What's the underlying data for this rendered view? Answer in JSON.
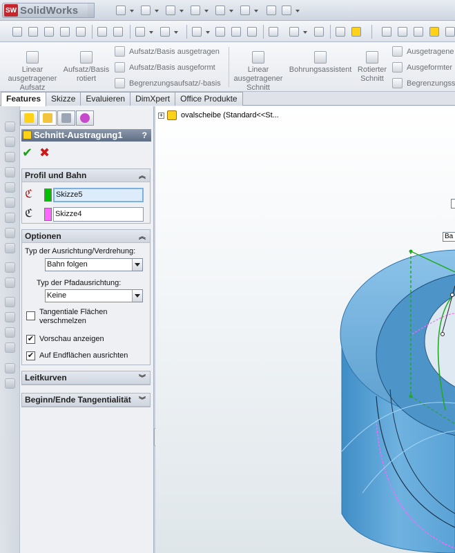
{
  "app": {
    "logo_mark": "SW",
    "title": "SolidWorks"
  },
  "command_manager": {
    "big_buttons": [
      {
        "id": "linear-extruded-boss",
        "label": "Linear\nausgetragener\nAufsatz"
      },
      {
        "id": "revolved-boss",
        "label": "Aufsatz/Basis\nrotiert"
      },
      {
        "id": "linear-extruded-cut",
        "label": "Linear\nausgetragener\nSchnitt"
      },
      {
        "id": "hole-wizard",
        "label": "Bohrungsassistent"
      },
      {
        "id": "revolved-cut",
        "label": "Rotierter\nSchnitt"
      }
    ],
    "small_buttons_col1": [
      "Aufsatz/Basis ausgetragen",
      "Aufsatz/Basis ausgeformt",
      "Begrenzungsaufsatz/-basis"
    ],
    "small_buttons_col2": [
      "Ausgetragene",
      "Ausgeformter",
      "Begrenzungss"
    ]
  },
  "tabs": [
    "Features",
    "Skizze",
    "Evaluieren",
    "DimXpert",
    "Office Produkte"
  ],
  "active_tab": "Features",
  "property_manager": {
    "title": "Schnitt-Austragung1",
    "help": "?",
    "ok_glyph": "✔",
    "cancel_glyph": "✖",
    "profile_group": {
      "title": "Profil und Bahn",
      "profile_value": "Skizze5",
      "path_value": "Skizze4",
      "profile_color": "#00c000",
      "path_color": "#ff66ff"
    },
    "options_group": {
      "title": "Optionen",
      "orientation_label": "Typ der Ausrichtung/Verdrehung:",
      "orientation_value": "Bahn folgen",
      "path_align_label": "Typ der Pfadausrichtung:",
      "path_align_value": "Keine",
      "checkboxes": [
        {
          "label": "Tangentiale Flächen\nverschmelzen",
          "checked": false
        },
        {
          "label": "Vorschau anzeigen",
          "checked": true
        },
        {
          "label": "Auf Endflächen ausrichten",
          "checked": true
        }
      ]
    },
    "collapsed_groups": [
      "Leitkurven",
      "Beginn/Ende Tangentialität"
    ]
  },
  "feature_tree": {
    "root": "ovalscheibe  (Standard<<St..."
  },
  "graphics": {
    "tag_label": "Ba",
    "body_color": "#5ba3d6",
    "profile_color": "#22aa22",
    "path_color": "#ff66ff"
  }
}
